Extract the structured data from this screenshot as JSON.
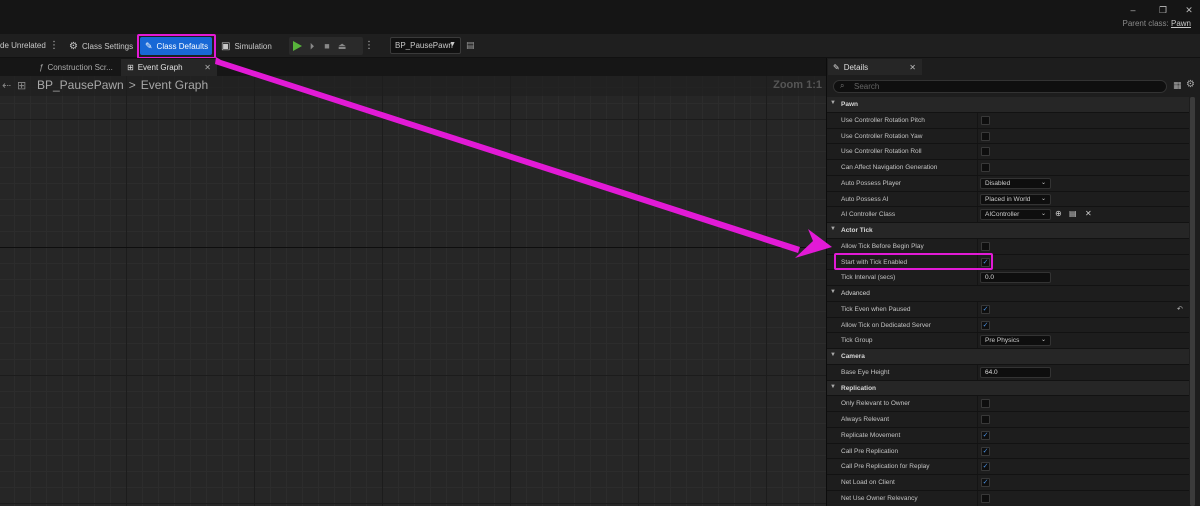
{
  "titlebar": {
    "parent_class_label": "Parent class:",
    "parent_class_value": "Pawn",
    "minimize": "–",
    "restore": "❐",
    "close": "✕"
  },
  "toolbar": {
    "hide_unrelated": "de Unrelated",
    "class_settings": "Class Settings",
    "class_defaults": "Class Defaults",
    "simulation": "Simulation",
    "debug_object": "BP_PausePawn"
  },
  "tabs": [
    {
      "label": "Construction Scr...",
      "icon": "ƒ"
    },
    {
      "label": "Event Graph",
      "close": "✕"
    }
  ],
  "graph": {
    "breadcrumb_root": "BP_PausePawn",
    "breadcrumb_sep": ">",
    "breadcrumb_leaf": "Event Graph",
    "zoom": "Zoom 1:1"
  },
  "details": {
    "tab_label": "Details",
    "tab_close": "✕",
    "search_placeholder": "Search",
    "rows": [
      {
        "type": "cat",
        "label": "Pawn"
      },
      {
        "type": "bool",
        "label": "Use Controller Rotation Pitch",
        "checked": false
      },
      {
        "type": "bool",
        "label": "Use Controller Rotation Yaw",
        "checked": false
      },
      {
        "type": "bool",
        "label": "Use Controller Rotation Roll",
        "checked": false
      },
      {
        "type": "bool",
        "label": "Can Affect Navigation Generation",
        "checked": false
      },
      {
        "type": "combo",
        "label": "Auto Possess Player",
        "value": "Disabled"
      },
      {
        "type": "combo",
        "label": "Auto Possess AI",
        "value": "Placed in World"
      },
      {
        "type": "class",
        "label": "AI Controller Class",
        "value": "AIController"
      },
      {
        "type": "cat",
        "label": "Actor Tick"
      },
      {
        "type": "bool",
        "label": "Allow Tick Before Begin Play",
        "checked": false
      },
      {
        "type": "bool",
        "label": "Start with Tick Enabled",
        "checked": true
      },
      {
        "type": "num",
        "label": "Tick Interval (secs)",
        "value": "0.0"
      },
      {
        "type": "subcat",
        "label": "Advanced"
      },
      {
        "type": "bool",
        "label": "Tick Even when Paused",
        "checked": true,
        "reset": true
      },
      {
        "type": "bool",
        "label": "Allow Tick on Dedicated Server",
        "checked": true
      },
      {
        "type": "combo",
        "label": "Tick Group",
        "value": "Pre Physics"
      },
      {
        "type": "cat",
        "label": "Camera"
      },
      {
        "type": "num",
        "label": "Base Eye Height",
        "value": "64.0"
      },
      {
        "type": "cat",
        "label": "Replication"
      },
      {
        "type": "bool",
        "label": "Only Relevant to Owner",
        "checked": false
      },
      {
        "type": "bool",
        "label": "Always Relevant",
        "checked": false
      },
      {
        "type": "bool",
        "label": "Replicate Movement",
        "checked": true
      },
      {
        "type": "bool",
        "label": "Call Pre Replication",
        "checked": true
      },
      {
        "type": "bool",
        "label": "Call Pre Replication for Replay",
        "checked": true
      },
      {
        "type": "bool",
        "label": "Net Load on Client",
        "checked": true
      },
      {
        "type": "bool",
        "label": "Net Use Owner Relevancy",
        "checked": false
      }
    ]
  },
  "colors": {
    "annotation": "#e21ad6",
    "accent": "#1868d6",
    "play": "#58b43b"
  }
}
